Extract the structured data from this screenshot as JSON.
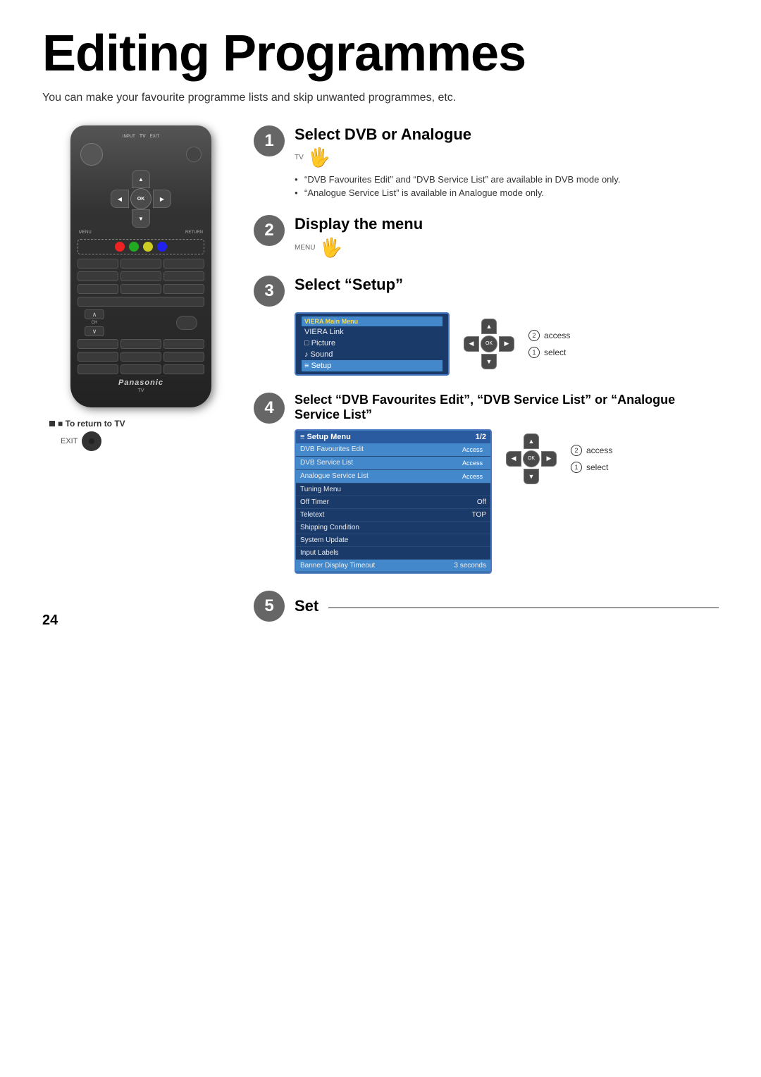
{
  "page": {
    "title": "Editing Programmes",
    "subtitle": "You can make your favourite programme lists and skip unwanted programmes, etc.",
    "page_number": "24"
  },
  "steps": [
    {
      "number": "1",
      "title": "Select DVB or Analogue",
      "bullets": [
        "“DVB Favourites Edit” and “DVB Service List” are available in DVB mode only.",
        "“Analogue Service List” is available in Analogue mode only."
      ]
    },
    {
      "number": "2",
      "title": "Display the menu",
      "label": "MENU"
    },
    {
      "number": "3",
      "title": "Select “Setup”",
      "nav_labels": [
        "access",
        "select"
      ],
      "menu_items": [
        {
          "label": "VIERA Main Menu",
          "highlighted": true
        },
        {
          "label": "VIERA Link",
          "highlighted": false
        },
        {
          "label": "□ Picture",
          "highlighted": false
        },
        {
          "label": "♪ Sound",
          "highlighted": false
        },
        {
          "label": "≡ Setup",
          "highlighted": true
        }
      ]
    },
    {
      "number": "4",
      "title": "Select “DVB Favourites Edit”, “DVB Service List” or “Analogue Service List”",
      "nav_labels": [
        "access",
        "select"
      ],
      "setup_menu": {
        "title": "≡ Setup Menu",
        "page": "1/2",
        "rows": [
          {
            "label": "DVB Favourites Edit",
            "value": "Access",
            "highlighted": true
          },
          {
            "label": "DVB Service List",
            "value": "Access",
            "highlighted": true
          },
          {
            "label": "Analogue Service List",
            "value": "Access",
            "highlighted": true
          },
          {
            "label": "Tuning Menu",
            "value": "",
            "highlighted": false
          },
          {
            "label": "Off Timer",
            "value": "Off",
            "highlighted": false
          },
          {
            "label": "Teletext",
            "value": "TOP",
            "highlighted": false
          },
          {
            "label": "Shipping Condition",
            "value": "",
            "highlighted": false
          },
          {
            "label": "System Update",
            "value": "",
            "highlighted": false
          },
          {
            "label": "Input Labels",
            "value": "",
            "highlighted": false
          },
          {
            "label": "Banner Display Timeout",
            "value": "3 seconds",
            "highlighted": true
          }
        ]
      }
    },
    {
      "number": "5",
      "title": "Set"
    }
  ],
  "remote": {
    "input_label": "INPUT",
    "tv_label": "TV",
    "exit_label": "EXIT",
    "menu_label": "MENU",
    "return_label": "RETURN",
    "ok_label": "OK",
    "ch_label": "CH",
    "panasonic_label": "Panasonic",
    "tv_bottom_label": "TV"
  },
  "to_return": {
    "label": "■ To return to TV",
    "sublabel": "EXIT"
  },
  "nav_labels": {
    "access": "Ⓐ access",
    "select": "① select"
  }
}
